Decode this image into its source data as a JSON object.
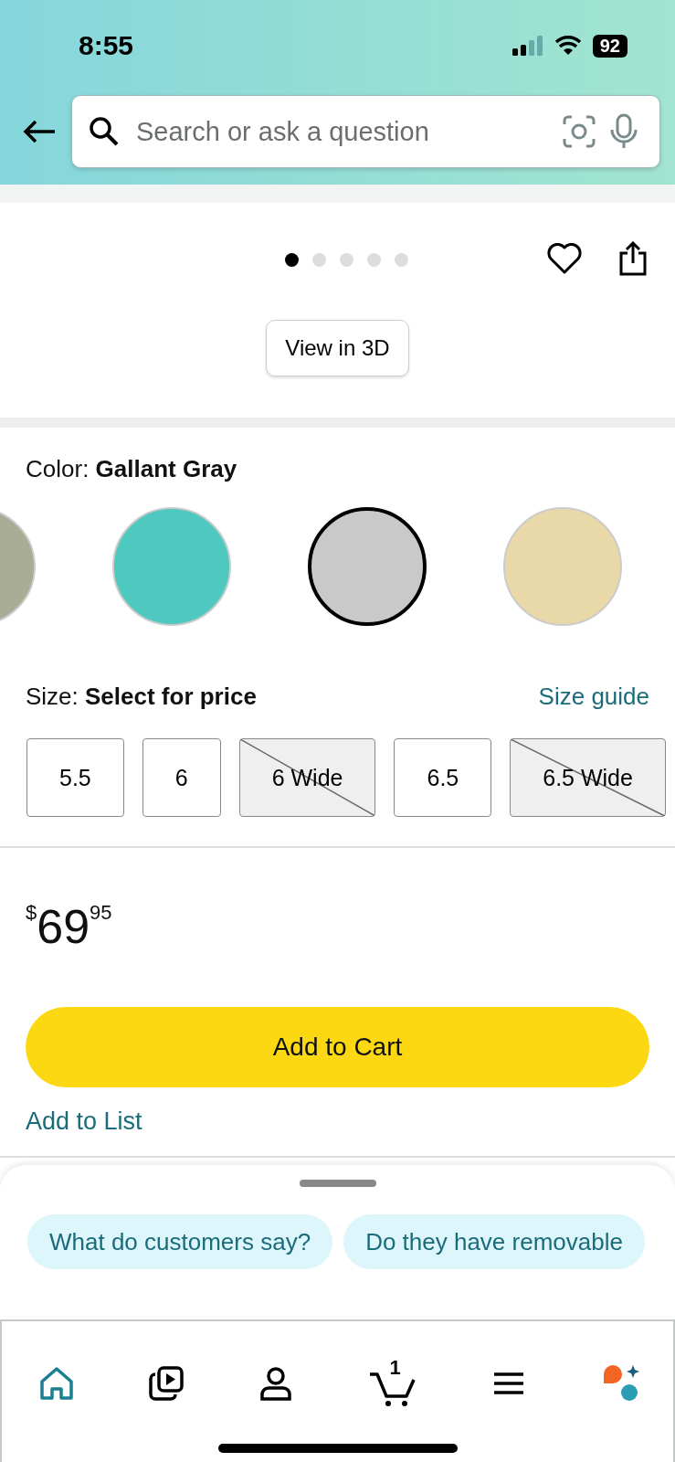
{
  "status_bar": {
    "time": "8:55",
    "battery": "92"
  },
  "search": {
    "placeholder": "Search or ask a question"
  },
  "gallery": {
    "dots": [
      {
        "selected": true
      },
      {
        "selected": false
      },
      {
        "selected": false
      },
      {
        "selected": false
      },
      {
        "selected": false
      }
    ],
    "view_3d": "View in 3D"
  },
  "color": {
    "label": "Color: ",
    "value": "Gallant Gray",
    "swatches": [
      {
        "color": "#a9ad95",
        "selected": false
      },
      {
        "color": "#4fc9c0",
        "selected": false
      },
      {
        "color": "#c9c9c9",
        "selected": true
      },
      {
        "color": "#e9d9a8",
        "selected": false
      }
    ]
  },
  "size": {
    "label": "Size: ",
    "value": "Select for price",
    "guide": "Size guide",
    "options": [
      {
        "label": "5.5",
        "available": true
      },
      {
        "label": "6",
        "available": true
      },
      {
        "label": "6 Wide",
        "available": false
      },
      {
        "label": "6.5",
        "available": true
      },
      {
        "label": "6.5 Wide",
        "available": false
      }
    ]
  },
  "price": {
    "currency": "$",
    "whole": "69",
    "fraction": "95"
  },
  "add_to_cart": "Add to Cart",
  "add_to_list": "Add to List",
  "suggestions": [
    "What do customers say?",
    "Do they have removable"
  ],
  "nav": [
    {
      "kind": "home",
      "selected": true
    },
    {
      "kind": "video",
      "selected": false
    },
    {
      "kind": "account",
      "selected": false
    },
    {
      "kind": "cart",
      "badge": "1",
      "selected": false
    },
    {
      "kind": "menu",
      "selected": false
    },
    {
      "kind": "assistant",
      "selected": false
    }
  ]
}
